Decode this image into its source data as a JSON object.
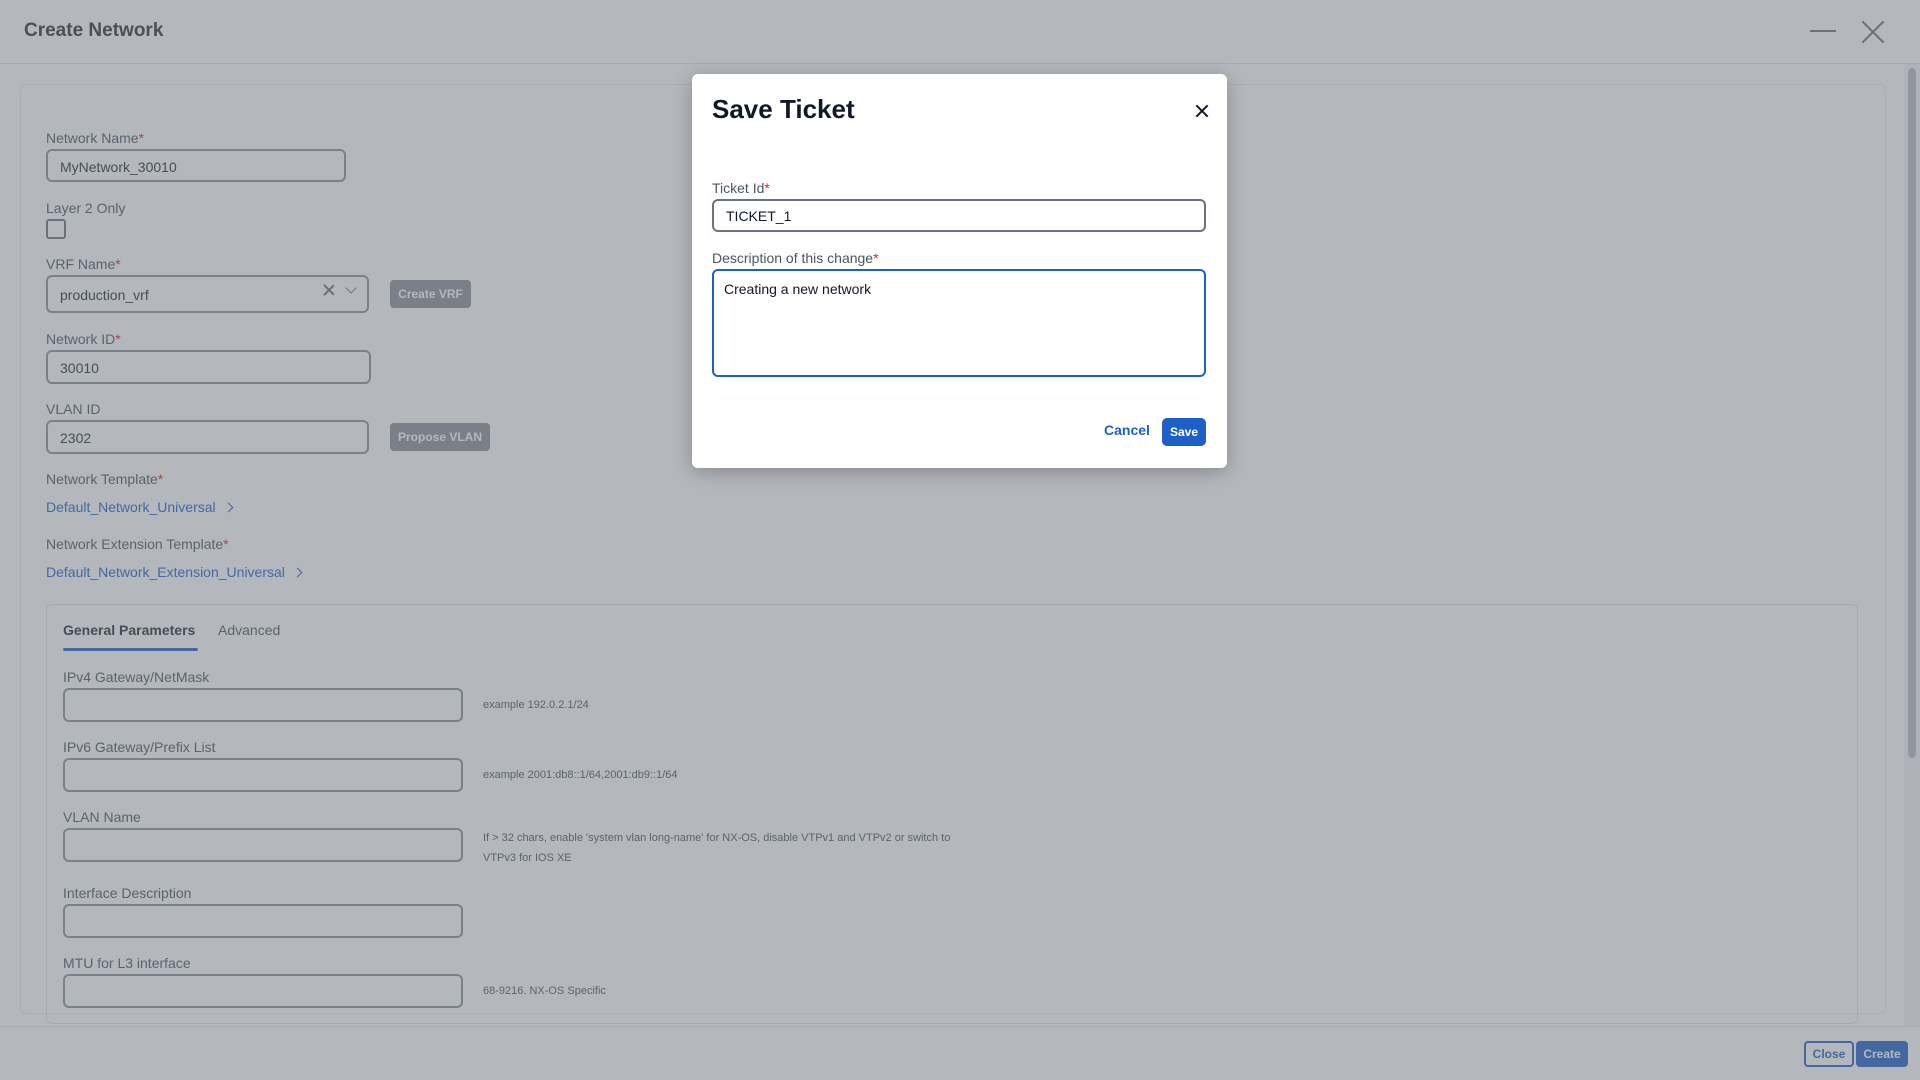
{
  "header": {
    "title": "Create Network"
  },
  "form": {
    "network_name": {
      "label": "Network Name",
      "value": "MyNetwork_30010"
    },
    "layer2_only": {
      "label": "Layer 2 Only"
    },
    "vrf_name": {
      "label": "VRF Name",
      "value": "production_vrf",
      "create_button": "Create VRF"
    },
    "network_id": {
      "label": "Network ID",
      "value": "30010"
    },
    "vlan_id": {
      "label": "VLAN ID",
      "value": "2302",
      "propose_button": "Propose VLAN"
    },
    "network_template": {
      "label": "Network Template",
      "value": "Default_Network_Universal"
    },
    "network_extension_template": {
      "label": "Network Extension Template",
      "value": "Default_Network_Extension_Universal"
    },
    "required_marker": "*"
  },
  "tabs": [
    {
      "label": "General Parameters",
      "active": true
    },
    {
      "label": "Advanced",
      "active": false
    }
  ],
  "params": {
    "ipv4": {
      "label": "IPv4 Gateway/NetMask",
      "hint": "example 192.0.2.1/24"
    },
    "ipv6": {
      "label": "IPv6 Gateway/Prefix List",
      "hint": "example 2001:db8::1/64,2001:db9::1/64"
    },
    "vlan_name": {
      "label": "VLAN Name",
      "hint_line1": "If > 32 chars, enable 'system vlan long-name' for NX-OS, disable VTPv1 and VTPv2 or switch to",
      "hint_line2": "VTPv3 for IOS XE"
    },
    "interface_description": {
      "label": "Interface Description"
    },
    "mtu": {
      "label": "MTU for L3 interface",
      "hint": "68-9216. NX-OS Specific"
    }
  },
  "footer": {
    "close_label": "Close",
    "create_label": "Create"
  },
  "modal": {
    "title": "Save Ticket",
    "ticket_id": {
      "label": "Ticket Id",
      "value": "TICKET_1"
    },
    "description": {
      "label": "Description of this change",
      "value": "Creating a new network"
    },
    "cancel_label": "Cancel",
    "save_label": "Save"
  },
  "icons": {
    "minimize": "minimize-icon",
    "close": "close-icon",
    "clear": "clear-icon",
    "dropdown": "chevron-down-icon",
    "link_chevron": "chevron-right-icon"
  },
  "colors": {
    "accent": "#1d61c8",
    "required": "#e0201a",
    "overlay": "#69707a"
  }
}
